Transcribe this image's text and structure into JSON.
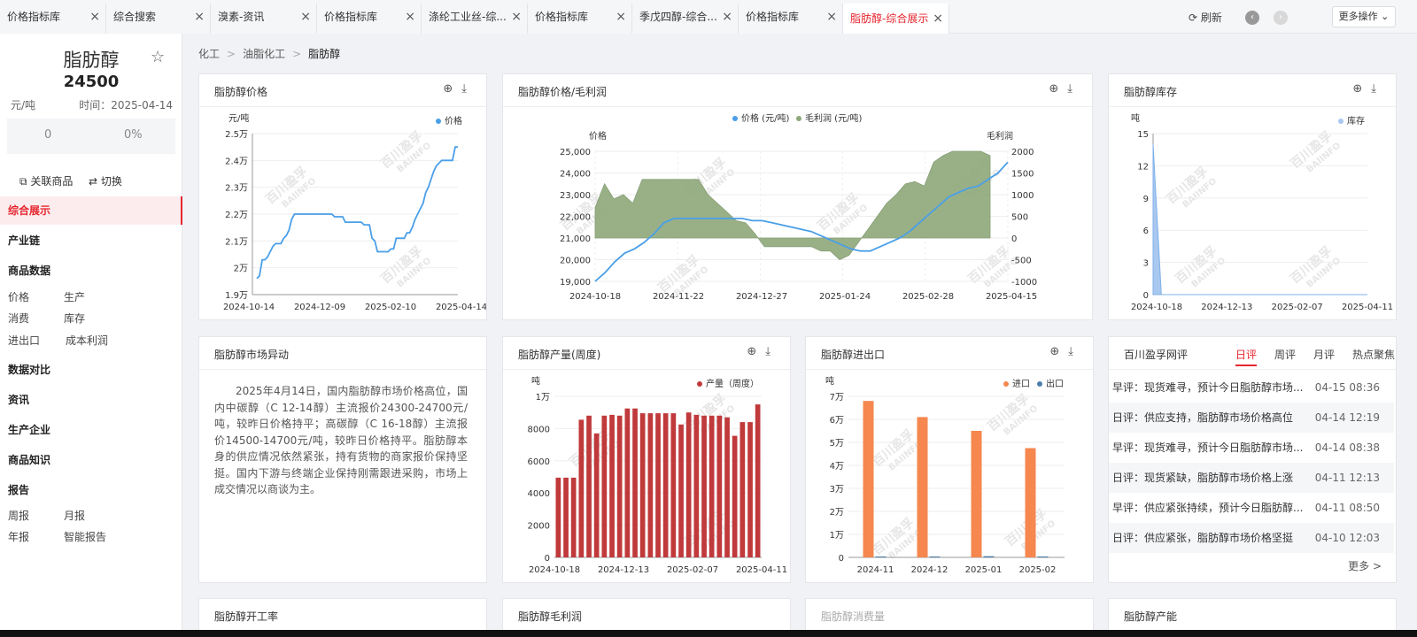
{
  "tabs": [
    {
      "label": "价格指标库",
      "active": false
    },
    {
      "label": "综合搜索",
      "active": false
    },
    {
      "label": "溴素-资讯",
      "active": false
    },
    {
      "label": "价格指标库",
      "active": false
    },
    {
      "label": "涤纶工业丝-综...",
      "active": false
    },
    {
      "label": "价格指标库",
      "active": false
    },
    {
      "label": "季戊四醇-综合...",
      "active": false
    },
    {
      "label": "价格指标库",
      "active": false
    },
    {
      "label": "脂肪醇-综合展示",
      "active": true
    }
  ],
  "toolbar": {
    "refresh": "刷新",
    "more": "更多操作",
    "close_icon": "×",
    "refresh_icon": "refresh-icon"
  },
  "product": {
    "name": "脂肪醇",
    "price": "24500",
    "unit": "元/吨",
    "time": "时间：2025-04-14",
    "change": "0",
    "change_pct": "0%",
    "related": "关联商品",
    "switch": "切换"
  },
  "nav": {
    "active": "综合展示",
    "sections": [
      "产业链",
      "商品数据",
      "数据对比",
      "资讯",
      "生产企业",
      "商品知识",
      "报告"
    ],
    "goods_items": [
      "价格",
      "生产",
      "消费",
      "库存",
      "进出口",
      "成本利润"
    ],
    "report_items": [
      "周报",
      "月报",
      "年报",
      "智能报告"
    ]
  },
  "breadcrumb": [
    "化工",
    "油脂化工",
    "脂肪醇"
  ],
  "watermark": [
    "百川盈孚",
    "BAIINFO"
  ],
  "cards": {
    "price": {
      "title": "脂肪醇价格"
    },
    "price_margin": {
      "title": "脂肪醇价格/毛利润"
    },
    "inventory": {
      "title": "脂肪醇库存"
    },
    "market": {
      "title": "脂肪醇市场异动",
      "text": "2025年4月14日，国内脂肪醇市场价格高位，国内中碳醇（C 12-14醇）主流报价24300-24700元/吨，较昨日价格持平；高碳醇（C 16-18醇）主流报价14500-14700元/吨，较昨日价格持平。脂肪醇本身的供应情况依然紧张，持有货物的商家报价保持坚挺。国内下游与终端企业保持刚需跟进采购，市场上成交情况以商谈为主。"
    },
    "output": {
      "title": "脂肪醇产量(周度)"
    },
    "trade": {
      "title": "脂肪醇进出口"
    },
    "review": {
      "title": "百川盈孚网评",
      "tabs": [
        "日评",
        "周评",
        "月评",
        "热点聚焦"
      ],
      "active_tab": "日评",
      "more": "更多 >",
      "items": [
        {
          "text": "早评：现货难寻，预计今日脂肪醇市场...",
          "date": "04-15 08:36"
        },
        {
          "text": "日评：供应支持，脂肪醇市场价格高位",
          "date": "04-14 12:19"
        },
        {
          "text": "早评：现货难寻，预计今日脂肪醇市场...",
          "date": "04-14 08:38"
        },
        {
          "text": "日评：现货紧缺，脂肪醇市场价格上涨",
          "date": "04-11 12:13"
        },
        {
          "text": "早评：供应紧张持续，预计今日脂肪醇...",
          "date": "04-11 08:50"
        },
        {
          "text": "日评：供应紧张，脂肪醇市场价格坚挺",
          "date": "04-10 12:03"
        }
      ]
    },
    "rate": {
      "title": "脂肪醇开工率"
    },
    "margin": {
      "title": "脂肪醇毛利润"
    },
    "consumption": {
      "title": "脂肪醇消费量"
    },
    "capacity": {
      "title": "脂肪醇产能"
    }
  },
  "chart_data": [
    {
      "id": "price",
      "type": "line",
      "title": "脂肪醇价格",
      "ylabel": "元/吨",
      "series": [
        {
          "name": "价格",
          "color": "#4a9fe8",
          "values": [
            19600,
            19700,
            20300,
            20300,
            20400,
            20600,
            20800,
            20900,
            20900,
            20900,
            21100,
            21200,
            21400,
            21800,
            22000,
            22000,
            22000,
            22000,
            22000,
            22000,
            22000,
            22000,
            22000,
            22000,
            22000,
            22000,
            22000,
            22000,
            22000,
            21900,
            21900,
            21900,
            21900,
            21700,
            21700,
            21700,
            21700,
            21700,
            21700,
            21700,
            21600,
            21600,
            21600,
            21100,
            21000,
            20600,
            20600,
            20600,
            20600,
            20600,
            20700,
            20700,
            21100,
            21100,
            21100,
            21100,
            21300,
            21300,
            21500,
            21800,
            22000,
            22200,
            22400,
            22800,
            23000,
            23300,
            23600,
            23800,
            23900,
            24000,
            24000,
            24000,
            24000,
            24000,
            24500,
            24500
          ]
        }
      ],
      "x_ticks": [
        "2024-10-14",
        "2024-12-09",
        "2025-02-10",
        "2025-04-14"
      ],
      "y_ticks": [
        "1.9万",
        "2万",
        "2.1万",
        "2.2万",
        "2.3万",
        "2.4万",
        "2.5万"
      ],
      "ylim": [
        19000,
        25000
      ]
    },
    {
      "id": "price_margin",
      "type": "line+area",
      "title": "脂肪醇价格/毛利润",
      "left_label": "价格",
      "right_label": "毛利润",
      "series": [
        {
          "name": "价格 (元/吨)",
          "color": "#4a9fe8",
          "axis": "left",
          "values": [
            19000,
            19400,
            19900,
            20300,
            20500,
            20800,
            21200,
            21700,
            21900,
            21900,
            21900,
            21900,
            21900,
            21900,
            21900,
            21900,
            21800,
            21800,
            21700,
            21600,
            21500,
            21400,
            21300,
            21100,
            20900,
            20700,
            20500,
            20400,
            20400,
            20600,
            20800,
            21000,
            21300,
            21700,
            22100,
            22500,
            22900,
            23100,
            23300,
            23400,
            23700,
            24000,
            24500
          ]
        },
        {
          "name": "毛利润 (元/吨)",
          "color": "#8fa87a",
          "axis": "right",
          "values": [
            700,
            1250,
            900,
            1000,
            800,
            1350,
            1350,
            1350,
            1350,
            1350,
            1350,
            1350,
            1000,
            800,
            600,
            400,
            350,
            100,
            -200,
            -200,
            -200,
            -200,
            -200,
            -200,
            -300,
            -300,
            -500,
            -400,
            -100,
            200,
            500,
            800,
            1000,
            1250,
            1300,
            1200,
            1750,
            1900,
            2000,
            2000,
            2000,
            2000,
            1900
          ]
        }
      ],
      "x_ticks": [
        "2024-10-18",
        "2024-11-22",
        "2024-12-27",
        "2025-01-24",
        "2025-02-28",
        "2025-04-15"
      ],
      "y_left_ticks": [
        "19,000",
        "20,000",
        "21,000",
        "22,000",
        "23,000",
        "24,000",
        "25,000"
      ],
      "y_right_ticks": [
        "-1000",
        "-500",
        "0",
        "500",
        "1000",
        "1500",
        "2000"
      ],
      "ylim_left": [
        19000,
        25000
      ],
      "ylim_right": [
        -1000,
        2000
      ]
    },
    {
      "id": "inventory",
      "type": "area",
      "title": "脂肪醇库存",
      "ylabel": "吨",
      "series": [
        {
          "name": "库存",
          "color": "#a9c8f0",
          "values": [
            14,
            0,
            0,
            0,
            0,
            0,
            0,
            0,
            0,
            0,
            0,
            0,
            0,
            0,
            0,
            0,
            0,
            0,
            0,
            0,
            0,
            0,
            0,
            0,
            0,
            0,
            0
          ]
        }
      ],
      "x_ticks": [
        "2024-10-18",
        "2024-12-13",
        "2025-02-07",
        "2025-04-11"
      ],
      "y_ticks": [
        "0",
        "3",
        "6",
        "9",
        "12",
        "15"
      ],
      "ylim": [
        0,
        15
      ]
    },
    {
      "id": "output",
      "type": "bar",
      "title": "脂肪醇产量(周度)",
      "ylabel": "吨",
      "series": [
        {
          "name": "产量（周度）",
          "color": "#c0393b",
          "values": [
            4950,
            4950,
            4950,
            8550,
            8800,
            7700,
            8800,
            8850,
            8800,
            9250,
            9250,
            8950,
            8950,
            8950,
            8950,
            8950,
            8250,
            9000,
            8850,
            8800,
            8800,
            8800,
            8700,
            7550,
            8400,
            8400,
            9500
          ]
        }
      ],
      "x_ticks": [
        "2024-10-18",
        "2024-12-13",
        "2025-02-07",
        "2025-04-11"
      ],
      "y_ticks": [
        "0",
        "2000",
        "4000",
        "6000",
        "8000",
        "1万"
      ],
      "ylim": [
        0,
        10000
      ]
    },
    {
      "id": "trade",
      "type": "bar",
      "title": "脂肪醇进出口",
      "ylabel": "吨",
      "categories": [
        "2024-11",
        "2024-12",
        "2025-01",
        "2025-02"
      ],
      "series": [
        {
          "name": "进口",
          "color": "#f5874f",
          "values": [
            68000,
            61000,
            55000,
            47500
          ]
        },
        {
          "name": "出口",
          "color": "#4b7ea8",
          "values": [
            300,
            200,
            500,
            300
          ]
        }
      ],
      "y_ticks": [
        "0",
        "1万",
        "2万",
        "3万",
        "4万",
        "5万",
        "6万",
        "7万"
      ],
      "ylim": [
        0,
        70000
      ]
    }
  ]
}
